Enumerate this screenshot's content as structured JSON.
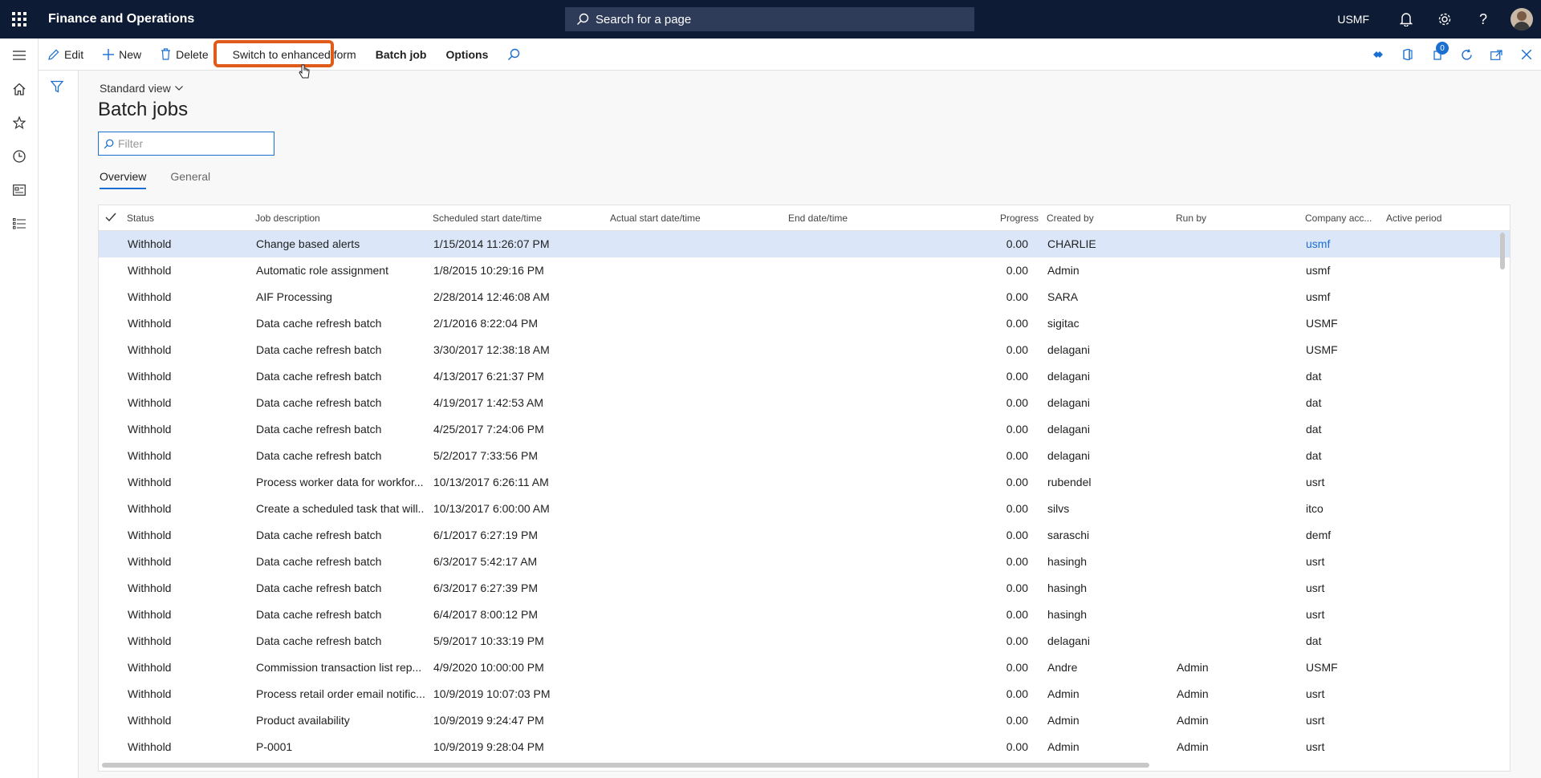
{
  "topbar": {
    "app_title": "Finance and Operations",
    "search_placeholder": "Search for a page",
    "company": "USMF"
  },
  "actions": {
    "edit": "Edit",
    "new": "New",
    "delete": "Delete",
    "switch_form": "Switch to enhanced form",
    "batch_job": "Batch job",
    "options": "Options",
    "notification_count": "0"
  },
  "page": {
    "view": "Standard view",
    "title": "Batch jobs",
    "filter_placeholder": "Filter"
  },
  "tabs": [
    "Overview",
    "General"
  ],
  "grid": {
    "columns": [
      "Status",
      "Job description",
      "Scheduled start date/time",
      "Actual start date/time",
      "End date/time",
      "Progress",
      "Created by",
      "Run by",
      "Company acc...",
      "Active period"
    ],
    "rows": [
      {
        "status": "Withhold",
        "desc": "Change based alerts",
        "sched": "1/15/2014 11:26:07 PM",
        "progress": "0.00",
        "created": "CHARLIE",
        "runby": "",
        "company": "usmf"
      },
      {
        "status": "Withhold",
        "desc": "Automatic role assignment",
        "sched": "1/8/2015 10:29:16 PM",
        "progress": "0.00",
        "created": "Admin",
        "runby": "",
        "company": "usmf"
      },
      {
        "status": "Withhold",
        "desc": "AIF Processing",
        "sched": "2/28/2014 12:46:08 AM",
        "progress": "0.00",
        "created": "SARA",
        "runby": "",
        "company": "usmf"
      },
      {
        "status": "Withhold",
        "desc": "Data cache refresh batch",
        "sched": "2/1/2016 8:22:04 PM",
        "progress": "0.00",
        "created": "sigitac",
        "runby": "",
        "company": "USMF"
      },
      {
        "status": "Withhold",
        "desc": "Data cache refresh batch",
        "sched": "3/30/2017 12:38:18 AM",
        "progress": "0.00",
        "created": "delagani",
        "runby": "",
        "company": "USMF"
      },
      {
        "status": "Withhold",
        "desc": "Data cache refresh batch",
        "sched": "4/13/2017 6:21:37 PM",
        "progress": "0.00",
        "created": "delagani",
        "runby": "",
        "company": "dat"
      },
      {
        "status": "Withhold",
        "desc": "Data cache refresh batch",
        "sched": "4/19/2017 1:42:53 AM",
        "progress": "0.00",
        "created": "delagani",
        "runby": "",
        "company": "dat"
      },
      {
        "status": "Withhold",
        "desc": "Data cache refresh batch",
        "sched": "4/25/2017 7:24:06 PM",
        "progress": "0.00",
        "created": "delagani",
        "runby": "",
        "company": "dat"
      },
      {
        "status": "Withhold",
        "desc": "Data cache refresh batch",
        "sched": "5/2/2017 7:33:56 PM",
        "progress": "0.00",
        "created": "delagani",
        "runby": "",
        "company": "dat"
      },
      {
        "status": "Withhold",
        "desc": "Process worker data for workfor...",
        "sched": "10/13/2017 6:26:11 AM",
        "progress": "0.00",
        "created": "rubendel",
        "runby": "",
        "company": "usrt"
      },
      {
        "status": "Withhold",
        "desc": "Create a scheduled task that will...",
        "sched": "10/13/2017 6:00:00 AM",
        "progress": "0.00",
        "created": "silvs",
        "runby": "",
        "company": "itco"
      },
      {
        "status": "Withhold",
        "desc": "Data cache refresh batch",
        "sched": "6/1/2017 6:27:19 PM",
        "progress": "0.00",
        "created": "saraschi",
        "runby": "",
        "company": "demf"
      },
      {
        "status": "Withhold",
        "desc": "Data cache refresh batch",
        "sched": "6/3/2017 5:42:17 AM",
        "progress": "0.00",
        "created": "hasingh",
        "runby": "",
        "company": "usrt"
      },
      {
        "status": "Withhold",
        "desc": "Data cache refresh batch",
        "sched": "6/3/2017 6:27:39 PM",
        "progress": "0.00",
        "created": "hasingh",
        "runby": "",
        "company": "usrt"
      },
      {
        "status": "Withhold",
        "desc": "Data cache refresh batch",
        "sched": "6/4/2017 8:00:12 PM",
        "progress": "0.00",
        "created": "hasingh",
        "runby": "",
        "company": "usrt"
      },
      {
        "status": "Withhold",
        "desc": "Data cache refresh batch",
        "sched": "5/9/2017 10:33:19 PM",
        "progress": "0.00",
        "created": "delagani",
        "runby": "",
        "company": "dat"
      },
      {
        "status": "Withhold",
        "desc": "Commission transaction list rep...",
        "sched": "4/9/2020 10:00:00 PM",
        "progress": "0.00",
        "created": "Andre",
        "runby": "Admin",
        "company": "USMF"
      },
      {
        "status": "Withhold",
        "desc": "Process retail order email notific...",
        "sched": "10/9/2019 10:07:03 PM",
        "progress": "0.00",
        "created": "Admin",
        "runby": "Admin",
        "company": "usrt"
      },
      {
        "status": "Withhold",
        "desc": "Product availability",
        "sched": "10/9/2019 9:24:47 PM",
        "progress": "0.00",
        "created": "Admin",
        "runby": "Admin",
        "company": "usrt"
      },
      {
        "status": "Withhold",
        "desc": "P-0001",
        "sched": "10/9/2019 9:28:04 PM",
        "progress": "0.00",
        "created": "Admin",
        "runby": "Admin",
        "company": "usrt"
      }
    ]
  }
}
